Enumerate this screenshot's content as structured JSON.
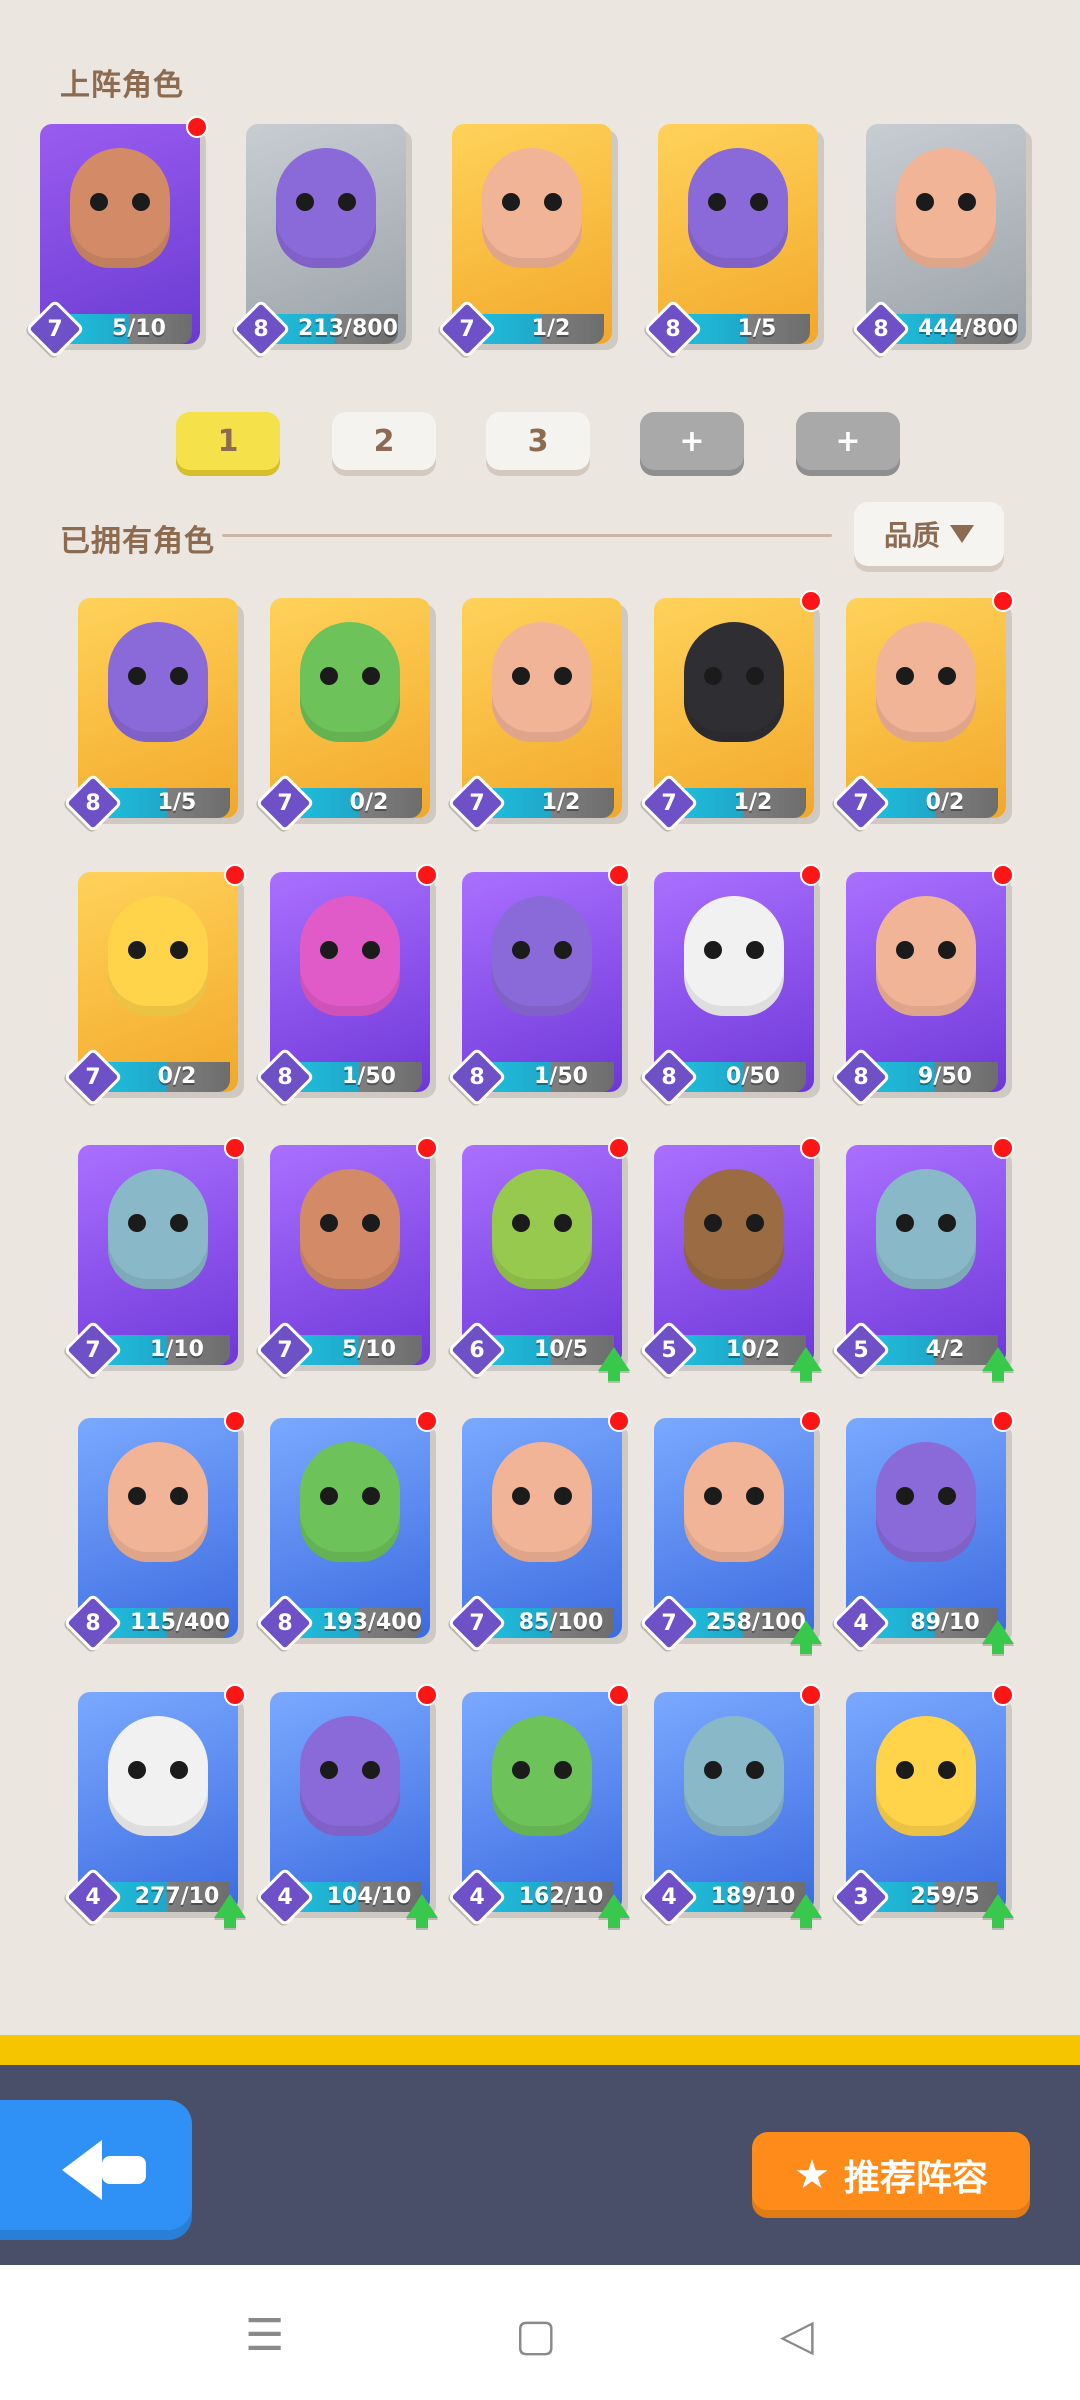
{
  "sections": {
    "deployed_title": "上阵角色",
    "owned_title": "已拥有角色"
  },
  "tabs": {
    "t1": "1",
    "t2": "2",
    "t3": "3",
    "add": "+"
  },
  "filter": {
    "label": "品质"
  },
  "deployed": [
    {
      "bg": "purple",
      "level": "7",
      "progress": "5/10",
      "dot": true,
      "skin": "tan-skin"
    },
    {
      "bg": "gray",
      "level": "8",
      "progress": "213/800",
      "dot": false,
      "skin": "purple-skin"
    },
    {
      "bg": "gold",
      "level": "7",
      "progress": "1/2",
      "dot": false,
      "skin": "skin"
    },
    {
      "bg": "gold",
      "level": "8",
      "progress": "1/5",
      "dot": false,
      "skin": "purple-skin"
    },
    {
      "bg": "gray",
      "level": "8",
      "progress": "444/800",
      "dot": false,
      "skin": "skin"
    }
  ],
  "owned": [
    {
      "bg": "gold",
      "level": "8",
      "progress": "1/5",
      "dot": false,
      "skin": "purple-skin"
    },
    {
      "bg": "gold",
      "level": "7",
      "progress": "0/2",
      "dot": false,
      "skin": "green-skin"
    },
    {
      "bg": "gold",
      "level": "7",
      "progress": "1/2",
      "dot": false,
      "skin": "skin"
    },
    {
      "bg": "gold",
      "level": "7",
      "progress": "1/2",
      "dot": true,
      "skin": "dark-skin"
    },
    {
      "bg": "gold",
      "level": "7",
      "progress": "0/2",
      "dot": true,
      "skin": "skin"
    },
    {
      "bg": "gold",
      "level": "7",
      "progress": "0/2",
      "dot": true,
      "skin": "yellow-skin"
    },
    {
      "bg": "violet",
      "level": "8",
      "progress": "1/50",
      "dot": true,
      "skin": "pink-skin"
    },
    {
      "bg": "violet",
      "level": "8",
      "progress": "1/50",
      "dot": true,
      "skin": "purple-skin"
    },
    {
      "bg": "violet",
      "level": "8",
      "progress": "0/50",
      "dot": true,
      "skin": "white-skin"
    },
    {
      "bg": "violet",
      "level": "8",
      "progress": "9/50",
      "dot": true,
      "skin": "skin"
    },
    {
      "bg": "violet",
      "level": "7",
      "progress": "1/10",
      "dot": true,
      "skin": "teal-skin"
    },
    {
      "bg": "violet",
      "level": "7",
      "progress": "5/10",
      "dot": true,
      "skin": "tan-skin"
    },
    {
      "bg": "violet",
      "level": "6",
      "progress": "10/5",
      "dot": true,
      "up": true,
      "skin": "lime-skin"
    },
    {
      "bg": "violet",
      "level": "5",
      "progress": "10/2",
      "dot": true,
      "up": true,
      "skin": "brown-skin"
    },
    {
      "bg": "violet",
      "level": "5",
      "progress": "4/2",
      "dot": true,
      "up": true,
      "skin": "teal-skin"
    },
    {
      "bg": "blue",
      "level": "8",
      "progress": "115/400",
      "dot": true,
      "skin": "skin"
    },
    {
      "bg": "blue",
      "level": "8",
      "progress": "193/400",
      "dot": true,
      "skin": "green-skin"
    },
    {
      "bg": "blue",
      "level": "7",
      "progress": "85/100",
      "dot": true,
      "skin": "skin"
    },
    {
      "bg": "blue",
      "level": "7",
      "progress": "258/100",
      "dot": true,
      "up": true,
      "skin": "skin"
    },
    {
      "bg": "blue",
      "level": "4",
      "progress": "89/10",
      "dot": true,
      "up": true,
      "skin": "purple-skin"
    },
    {
      "bg": "blue",
      "level": "4",
      "progress": "277/10",
      "dot": true,
      "up": true,
      "skin": "white-skin"
    },
    {
      "bg": "blue",
      "level": "4",
      "progress": "104/10",
      "dot": true,
      "up": true,
      "skin": "purple-skin"
    },
    {
      "bg": "blue",
      "level": "4",
      "progress": "162/10",
      "dot": true,
      "up": true,
      "skin": "green-skin"
    },
    {
      "bg": "blue",
      "level": "4",
      "progress": "189/10",
      "dot": true,
      "up": true,
      "skin": "teal-skin"
    },
    {
      "bg": "blue",
      "level": "3",
      "progress": "259/5",
      "dot": true,
      "up": true,
      "skin": "yellow-skin"
    }
  ],
  "bottom": {
    "recommend_label": "推荐阵容"
  },
  "icons": {
    "back": "back-arrow-icon",
    "star": "star-icon",
    "menu": "menu-icon",
    "home": "home-icon",
    "back_nav": "back-triangle-icon"
  }
}
